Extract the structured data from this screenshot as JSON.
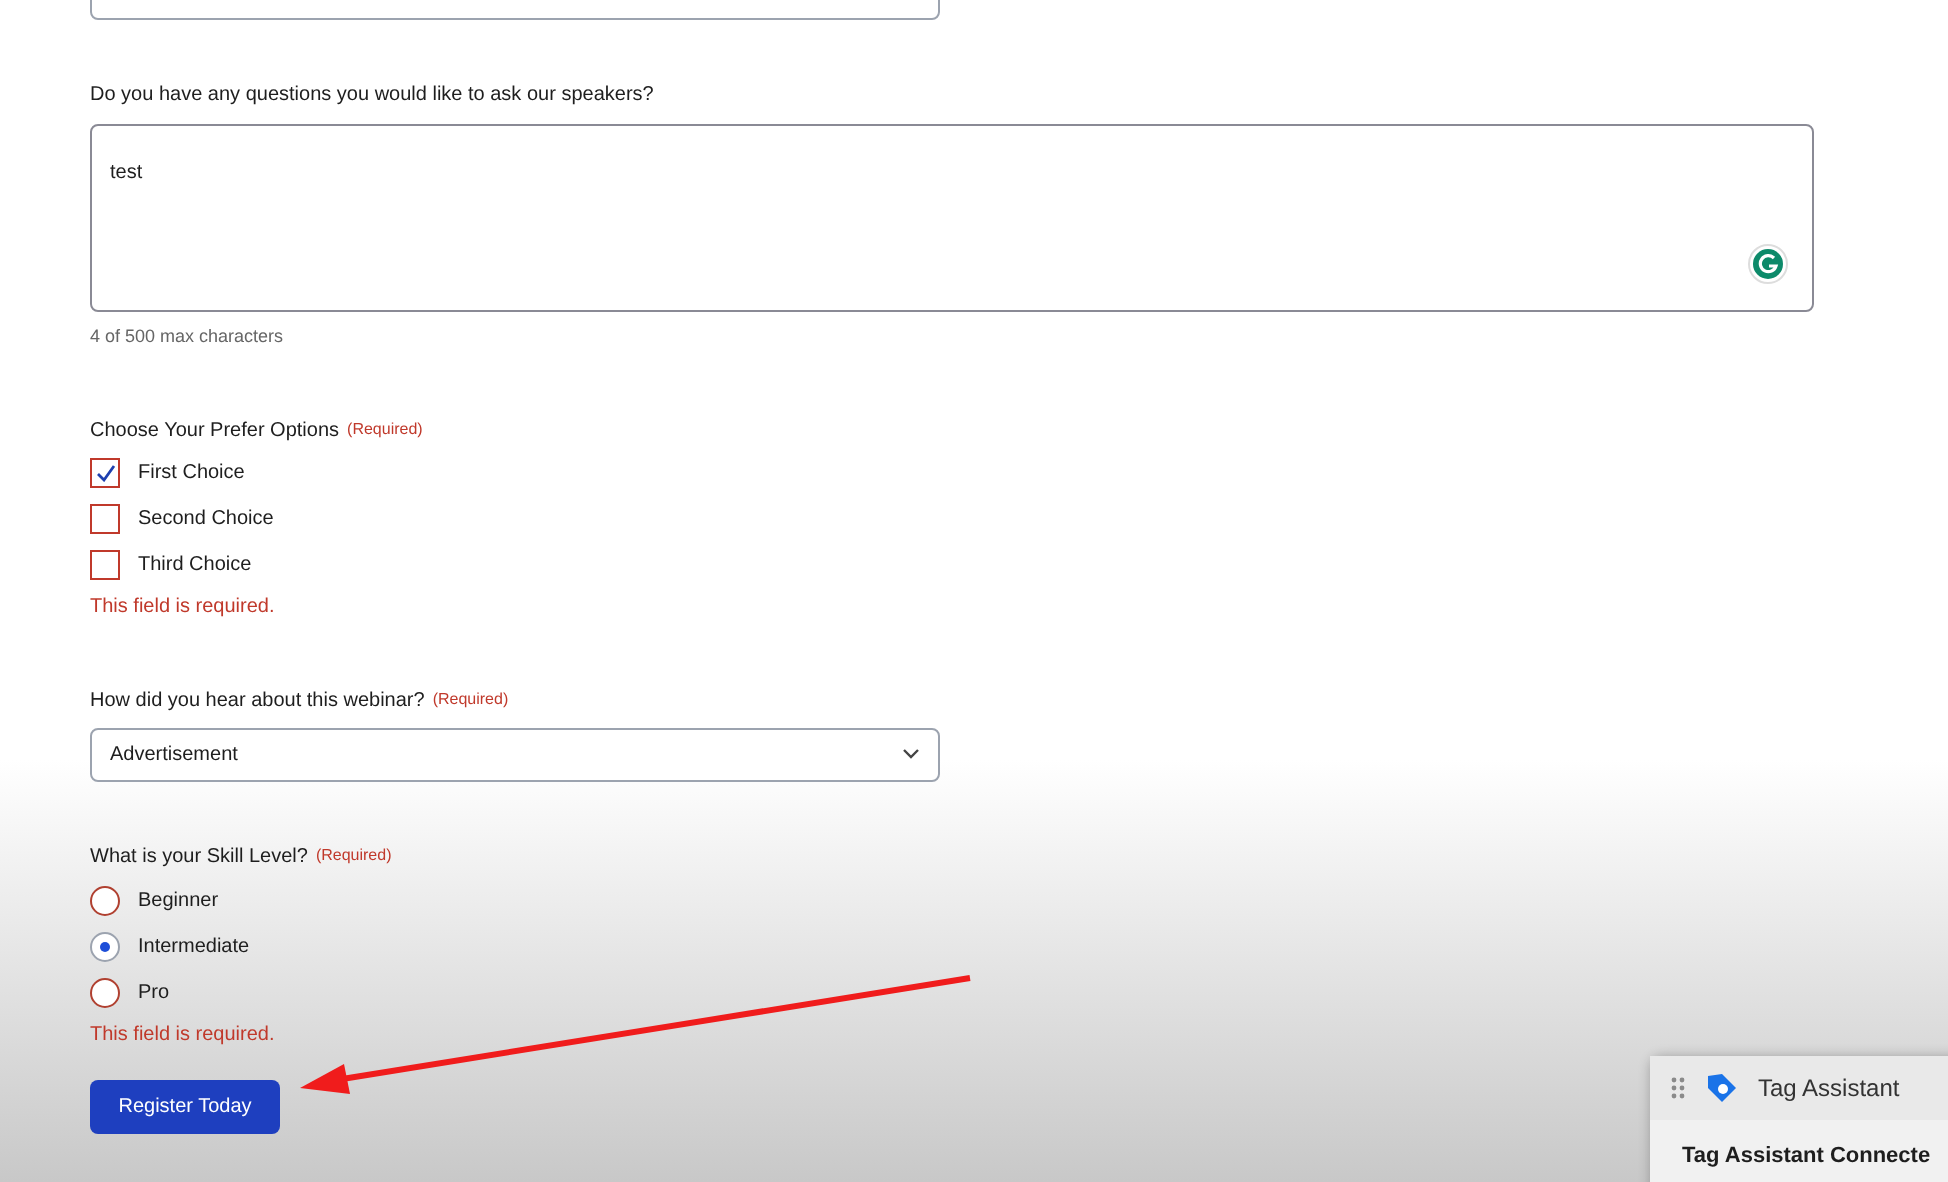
{
  "questions": {
    "label": "Do you have any questions you would like to ask our speakers?",
    "value": "test",
    "counter": "4 of 500 max characters"
  },
  "options": {
    "label": "Choose Your Prefer Options",
    "required": "(Required)",
    "items": [
      {
        "label": "First Choice",
        "checked": true
      },
      {
        "label": "Second Choice",
        "checked": false
      },
      {
        "label": "Third Choice",
        "checked": false
      }
    ],
    "error": "This field is required."
  },
  "source": {
    "label": "How did you hear about this webinar?",
    "required": "(Required)",
    "value": "Advertisement"
  },
  "skill": {
    "label": "What is your Skill Level?",
    "required": "(Required)",
    "items": [
      {
        "label": "Beginner",
        "selected": false
      },
      {
        "label": "Intermediate",
        "selected": true
      },
      {
        "label": "Pro",
        "selected": false
      }
    ],
    "error": "This field is required."
  },
  "submit": "Register Today",
  "tag_assistant": {
    "title": "Tag Assistant",
    "status": "Tag Assistant Connecte"
  }
}
